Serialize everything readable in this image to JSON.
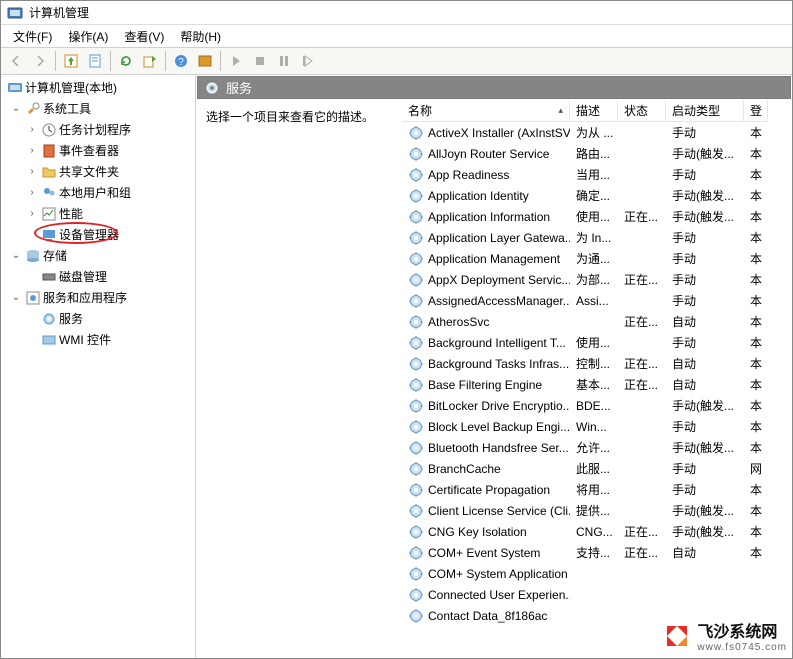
{
  "title": "计算机管理",
  "menubar": {
    "file": "文件(F)",
    "action": "操作(A)",
    "view": "查看(V)",
    "help": "帮助(H)"
  },
  "tree": {
    "root": "计算机管理(本地)",
    "system_tools": "系统工具",
    "task_scheduler": "任务计划程序",
    "event_viewer": "事件查看器",
    "shared_folders": "共享文件夹",
    "local_users": "本地用户和组",
    "performance": "性能",
    "device_manager": "设备管理器",
    "storage": "存储",
    "disk_management": "磁盘管理",
    "services_apps": "服务和应用程序",
    "services": "服务",
    "wmi_control": "WMI 控件"
  },
  "panel_title": "服务",
  "desc_hint": "选择一个项目来查看它的描述。",
  "columns": {
    "name": "名称",
    "desc": "描述",
    "status": "状态",
    "startup": "启动类型",
    "logon": "登"
  },
  "services": [
    {
      "name": "ActiveX Installer (AxInstSV)",
      "desc": "为从 ...",
      "status": "",
      "startup": "手动",
      "logon": "本"
    },
    {
      "name": "AllJoyn Router Service",
      "desc": "路由...",
      "status": "",
      "startup": "手动(触发...",
      "logon": "本"
    },
    {
      "name": "App Readiness",
      "desc": "当用...",
      "status": "",
      "startup": "手动",
      "logon": "本"
    },
    {
      "name": "Application Identity",
      "desc": "确定...",
      "status": "",
      "startup": "手动(触发...",
      "logon": "本"
    },
    {
      "name": "Application Information",
      "desc": "使用...",
      "status": "正在...",
      "startup": "手动(触发...",
      "logon": "本"
    },
    {
      "name": "Application Layer Gatewa...",
      "desc": "为 In...",
      "status": "",
      "startup": "手动",
      "logon": "本"
    },
    {
      "name": "Application Management",
      "desc": "为通...",
      "status": "",
      "startup": "手动",
      "logon": "本"
    },
    {
      "name": "AppX Deployment Servic...",
      "desc": "为部...",
      "status": "正在...",
      "startup": "手动",
      "logon": "本"
    },
    {
      "name": "AssignedAccessManager...",
      "desc": "Assi...",
      "status": "",
      "startup": "手动",
      "logon": "本"
    },
    {
      "name": "AtherosSvc",
      "desc": "",
      "status": "正在...",
      "startup": "自动",
      "logon": "本"
    },
    {
      "name": "Background Intelligent T...",
      "desc": "使用...",
      "status": "",
      "startup": "手动",
      "logon": "本"
    },
    {
      "name": "Background Tasks Infras...",
      "desc": "控制...",
      "status": "正在...",
      "startup": "自动",
      "logon": "本"
    },
    {
      "name": "Base Filtering Engine",
      "desc": "基本...",
      "status": "正在...",
      "startup": "自动",
      "logon": "本"
    },
    {
      "name": "BitLocker Drive Encryptio...",
      "desc": "BDE...",
      "status": "",
      "startup": "手动(触发...",
      "logon": "本"
    },
    {
      "name": "Block Level Backup Engi...",
      "desc": "Win...",
      "status": "",
      "startup": "手动",
      "logon": "本"
    },
    {
      "name": "Bluetooth Handsfree Ser...",
      "desc": "允许...",
      "status": "",
      "startup": "手动(触发...",
      "logon": "本"
    },
    {
      "name": "BranchCache",
      "desc": "此服...",
      "status": "",
      "startup": "手动",
      "logon": "网"
    },
    {
      "name": "Certificate Propagation",
      "desc": "将用...",
      "status": "",
      "startup": "手动",
      "logon": "本"
    },
    {
      "name": "Client License Service (Cli...",
      "desc": "提供...",
      "status": "",
      "startup": "手动(触发...",
      "logon": "本"
    },
    {
      "name": "CNG Key Isolation",
      "desc": "CNG...",
      "status": "正在...",
      "startup": "手动(触发...",
      "logon": "本"
    },
    {
      "name": "COM+ Event System",
      "desc": "支持...",
      "status": "正在...",
      "startup": "自动",
      "logon": "本"
    },
    {
      "name": "COM+ System Application",
      "desc": "",
      "status": "",
      "startup": "",
      "logon": ""
    },
    {
      "name": "Connected User Experien...",
      "desc": "",
      "status": "",
      "startup": "",
      "logon": ""
    },
    {
      "name": "Contact Data_8f186ac",
      "desc": "",
      "status": "",
      "startup": "",
      "logon": ""
    }
  ],
  "watermark": {
    "brand": "飞沙系统网",
    "sub": "www.fs0745.com"
  }
}
